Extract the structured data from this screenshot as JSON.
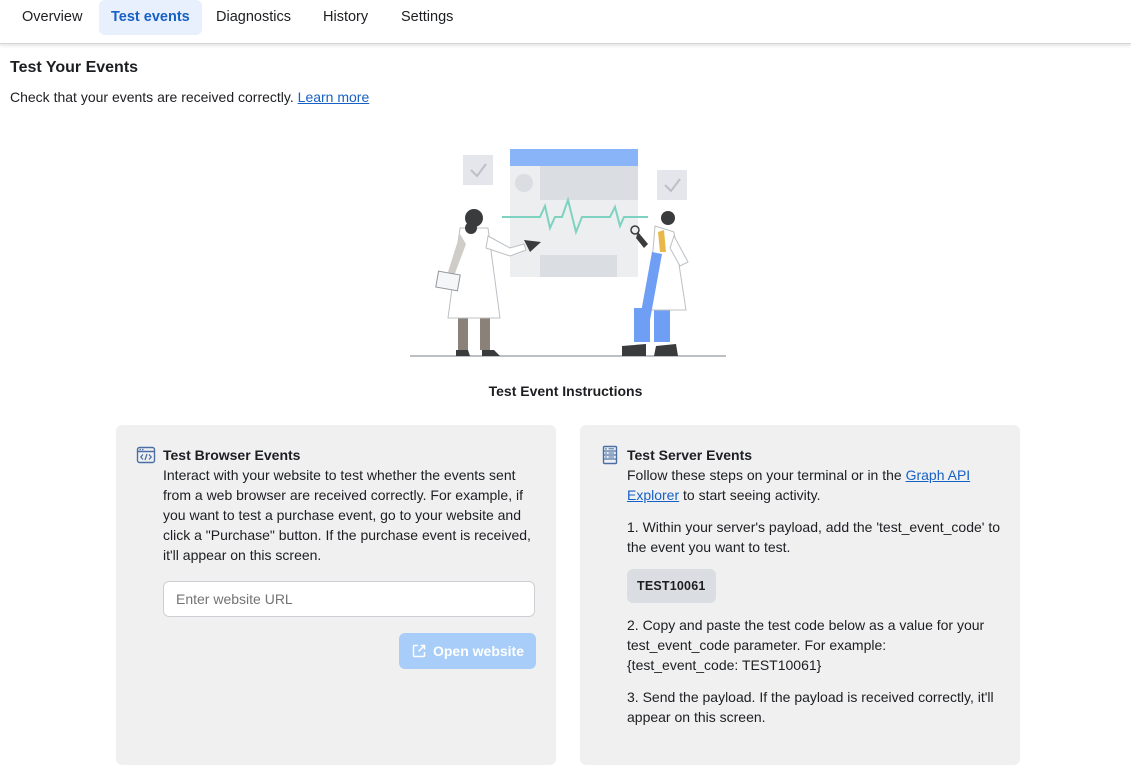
{
  "tabs": [
    {
      "label": "Overview",
      "active": false
    },
    {
      "label": "Test events",
      "active": true
    },
    {
      "label": "Diagnostics",
      "active": false
    },
    {
      "label": "History",
      "active": false
    },
    {
      "label": "Settings",
      "active": false
    }
  ],
  "header": {
    "title": "Test Your Events",
    "subtitle": "Check that your events are received correctly.",
    "learn_more": "Learn more"
  },
  "illustration": {
    "icon": "doctors-monitor-illustration"
  },
  "instructions_title": "Test Event Instructions",
  "browser_card": {
    "icon": "code-window-icon",
    "title": "Test Browser Events",
    "description": "Interact with your website to test whether the events sent from a web browser are received correctly. For example, if you want to test a purchase event, go to your website and click a \"Purchase\" button. If the purchase event is received, it'll appear on this screen.",
    "url_input": {
      "value": "",
      "placeholder": "Enter website URL"
    },
    "open_button": {
      "label": "Open website",
      "icon": "external-link-icon",
      "enabled": false
    }
  },
  "server_card": {
    "icon": "server-icon",
    "title": "Test Server Events",
    "intro_before": "Follow these steps on your terminal or in the ",
    "intro_link": "Graph API Explorer",
    "intro_after": " to start seeing activity.",
    "step1": "1. Within your server's payload, add the 'test_event_code' to the event you want to test.",
    "test_code": "TEST10061",
    "step2": "2. Copy and paste the test code below as a value for your test_event_code parameter. For example: {test_event_code: TEST10061}",
    "step3": "3. Send the payload. If the payload is received correctly, it'll appear on this screen."
  },
  "colors": {
    "accent": "#1761c4",
    "tab_active_bg": "#e7f0fc",
    "card_bg": "#f0f0f1",
    "button_disabled": "#a7cdf8"
  }
}
